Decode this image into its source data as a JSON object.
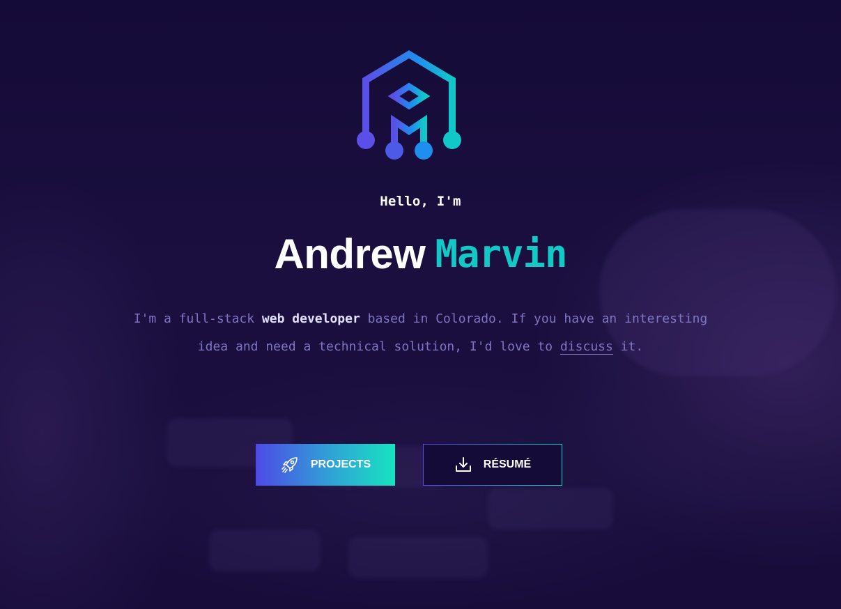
{
  "hero": {
    "greeting": "Hello, I'm",
    "first_name": "Andrew",
    "last_name": "Marvin",
    "intro_part1": "I'm a full-stack ",
    "intro_bold": "web developer",
    "intro_part2": " based in Colorado. If you have an interesting idea and need a technical solution, I'd love to ",
    "intro_link": "discuss",
    "intro_part3": " it."
  },
  "buttons": {
    "projects_label": "PROJECTS",
    "projects_icon": "rocket-icon",
    "resume_label": "RÉSUMÉ",
    "resume_icon": "download-icon"
  },
  "colors": {
    "background": "#140a36",
    "accent_teal": "#13c9c6",
    "accent_purple": "#4e4ae6",
    "text_muted": "#7f75c2"
  }
}
